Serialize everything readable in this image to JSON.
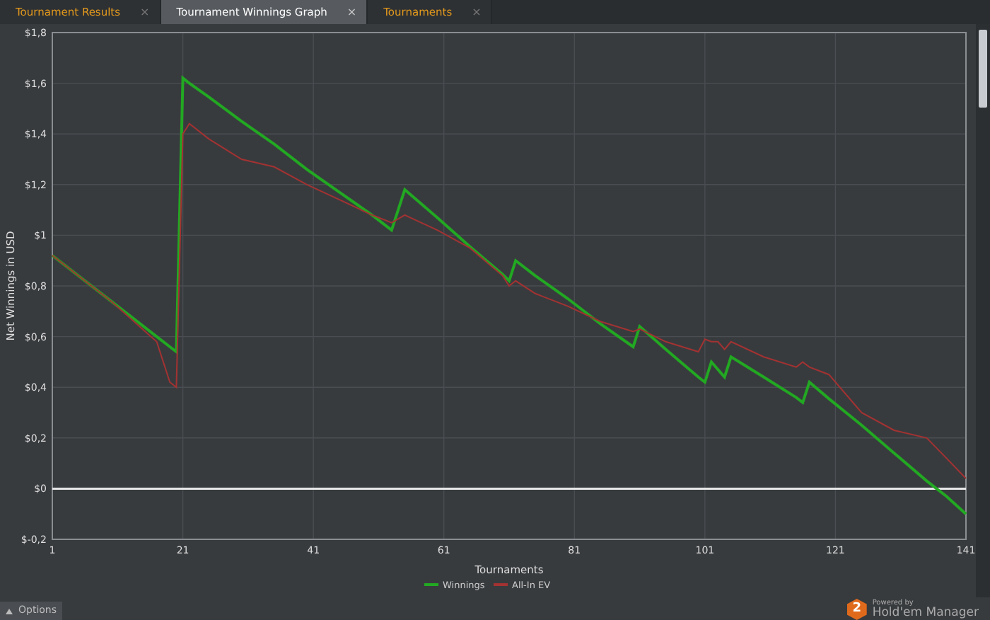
{
  "tabs": [
    {
      "label": "Tournament Results",
      "close": "×",
      "selected": false
    },
    {
      "label": "Tournament Winnings Graph",
      "close": "×",
      "selected": true
    },
    {
      "label": "Tournaments",
      "close": "×",
      "selected": false
    }
  ],
  "chart_data": {
    "type": "line",
    "xlabel": "Tournaments",
    "ylabel": "Net Winnings in USD",
    "x": [
      1,
      10,
      17,
      19,
      20,
      21,
      22,
      25,
      30,
      35,
      40,
      45,
      50,
      53,
      55,
      60,
      65,
      70,
      71,
      72,
      75,
      80,
      85,
      90,
      91,
      95,
      100,
      101,
      102,
      103,
      104,
      105,
      110,
      115,
      116,
      117,
      120,
      125,
      130,
      135,
      138,
      141
    ],
    "series": [
      {
        "name": "Winnings",
        "color": "#22a822",
        "values": [
          0.92,
          0.74,
          0.6,
          0.56,
          0.54,
          1.62,
          1.6,
          1.545,
          1.45,
          1.36,
          1.26,
          1.17,
          1.08,
          1.02,
          1.18,
          1.07,
          0.955,
          0.845,
          0.82,
          0.9,
          0.84,
          0.75,
          0.65,
          0.56,
          0.64,
          0.55,
          0.44,
          0.42,
          0.5,
          0.47,
          0.44,
          0.52,
          0.44,
          0.36,
          0.34,
          0.42,
          0.355,
          0.25,
          0.14,
          0.03,
          -0.03,
          -0.1
        ]
      },
      {
        "name": "All-In EV",
        "color": "#a33232",
        "values": [
          0.92,
          0.74,
          0.58,
          0.42,
          0.4,
          1.4,
          1.44,
          1.38,
          1.3,
          1.27,
          1.2,
          1.14,
          1.08,
          1.05,
          1.08,
          1.02,
          0.95,
          0.84,
          0.8,
          0.82,
          0.77,
          0.72,
          0.66,
          0.62,
          0.63,
          0.58,
          0.54,
          0.59,
          0.58,
          0.58,
          0.55,
          0.58,
          0.52,
          0.48,
          0.5,
          0.48,
          0.45,
          0.3,
          0.23,
          0.2,
          0.12,
          0.04
        ]
      }
    ],
    "grid": true,
    "legend": "bottom",
    "xlim": [
      1,
      141
    ],
    "ylim": [
      -0.2,
      1.8
    ],
    "xticks": [
      1,
      21,
      41,
      61,
      81,
      101,
      121,
      141
    ],
    "yticks": [
      {
        "value": -0.2,
        "label": "$-0,2"
      },
      {
        "value": 0,
        "label": "$0"
      },
      {
        "value": 0.2,
        "label": "$0,2"
      },
      {
        "value": 0.4,
        "label": "$0,4"
      },
      {
        "value": 0.6,
        "label": "$0,6"
      },
      {
        "value": 0.8,
        "label": "$0,8"
      },
      {
        "value": 1,
        "label": "$1"
      },
      {
        "value": 1.2,
        "label": "$1,2"
      },
      {
        "value": 1.4,
        "label": "$1,4"
      },
      {
        "value": 1.6,
        "label": "$1,6"
      },
      {
        "value": 1.8,
        "label": "$1,8"
      }
    ]
  },
  "options_button": {
    "label": "Options"
  },
  "logo": {
    "badge": "2",
    "tagline": "Powered by",
    "name": "Hold'em Manager"
  }
}
